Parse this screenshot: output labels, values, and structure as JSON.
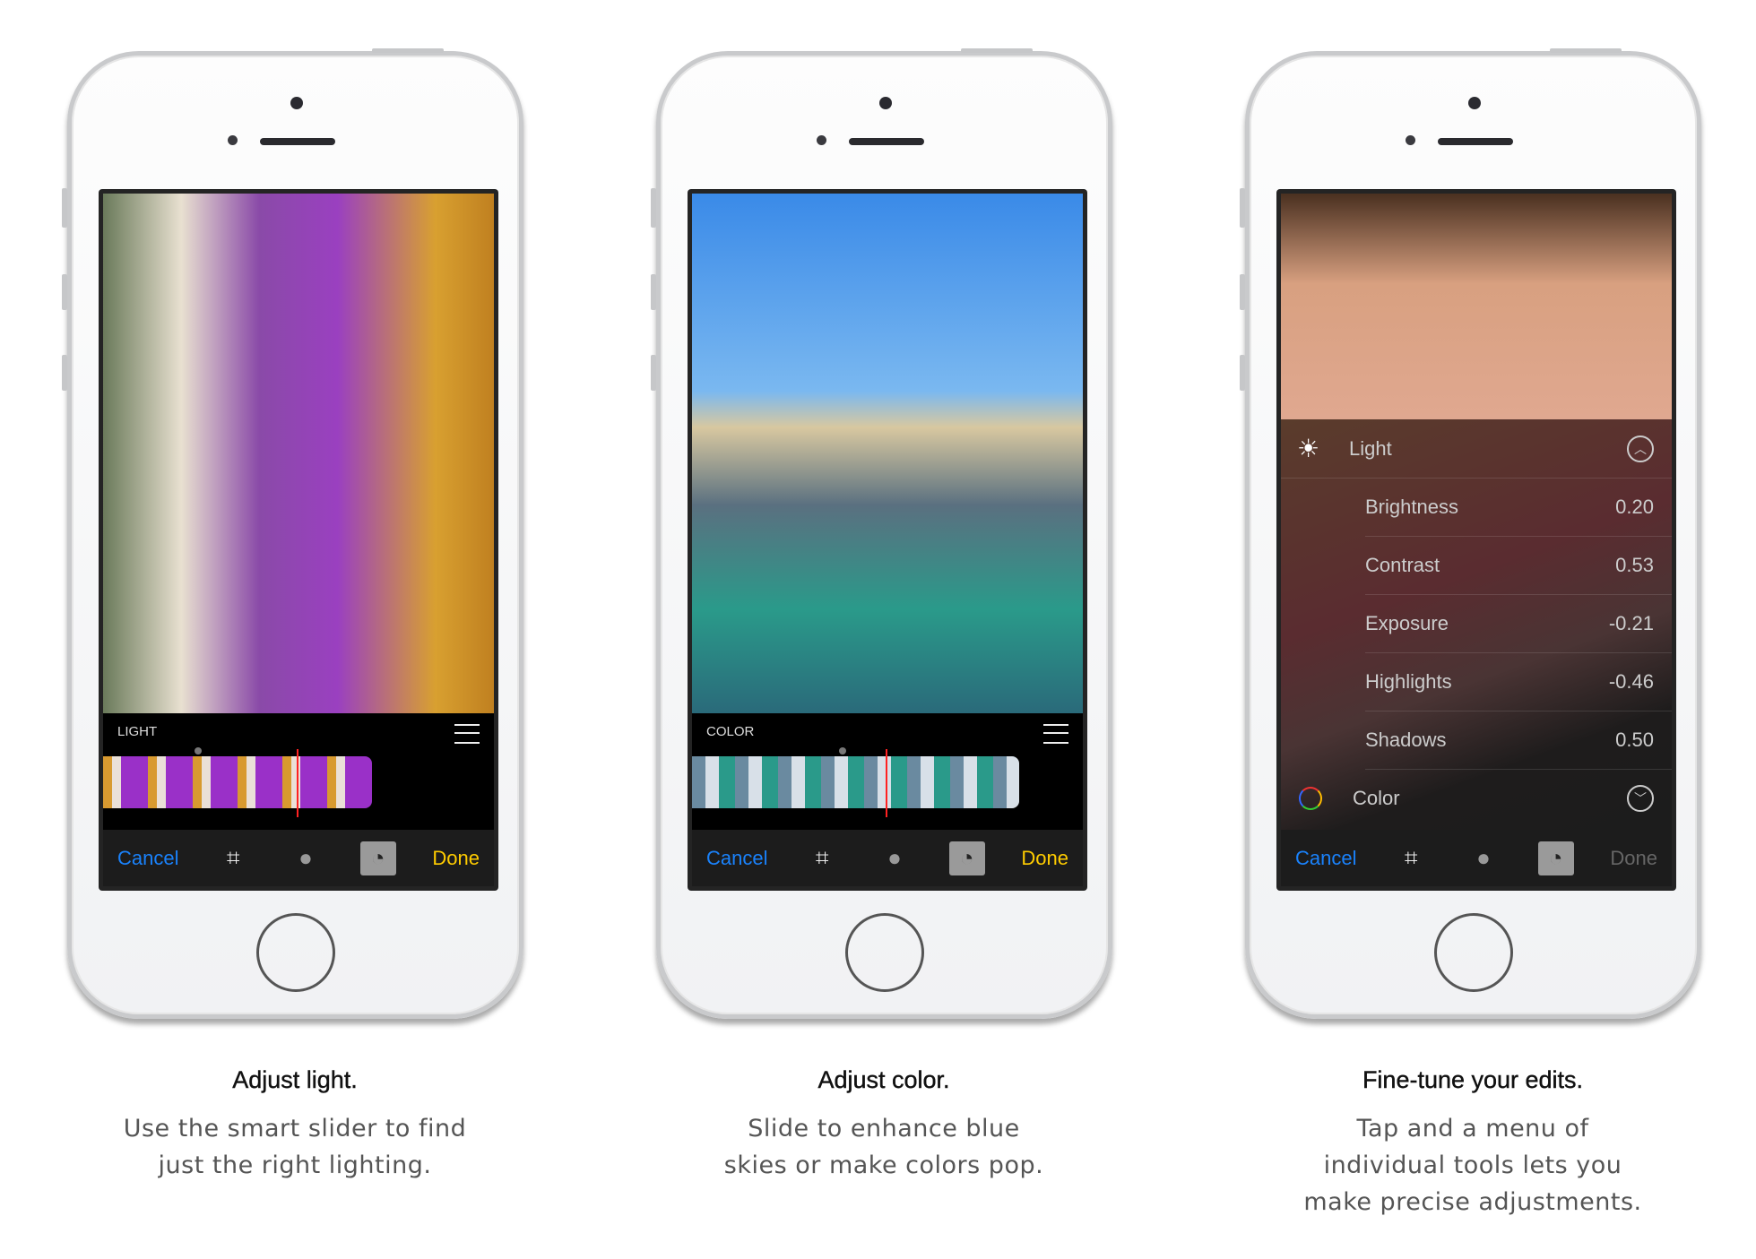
{
  "phones": [
    {
      "mode": "light",
      "control_label": "LIGHT",
      "cancel": "Cancel",
      "done": "Done",
      "done_color": "#ffcc00",
      "photo": "girl-popsicle-porch",
      "caption": {
        "title": "Adjust light.",
        "body": "Use the smart slider to find just the right lighting."
      }
    },
    {
      "mode": "color",
      "control_label": "COLOR",
      "cancel": "Cancel",
      "done": "Done",
      "done_color": "#ffcc00",
      "photo": "girl-beach-binoculars",
      "caption": {
        "title": "Adjust color.",
        "body": "Slide to enhance blue skies or make colors pop."
      }
    },
    {
      "mode": "menu",
      "cancel": "Cancel",
      "done": "Done",
      "done_color": "#666666",
      "photo": "girl-face-closeup",
      "menu": {
        "light_label": "Light",
        "color_label": "Color",
        "items": [
          {
            "label": "Brightness",
            "value": "0.20"
          },
          {
            "label": "Contrast",
            "value": "0.53"
          },
          {
            "label": "Exposure",
            "value": "-0.21"
          },
          {
            "label": "Highlights",
            "value": "-0.46"
          },
          {
            "label": "Shadows",
            "value": "0.50"
          }
        ]
      },
      "caption": {
        "title": "Fine-tune your edits.",
        "body": "Tap and a menu of individual tools lets you make precise adjustments."
      }
    }
  ],
  "accent": "#1a82fb",
  "icons": [
    "crop-icon",
    "filters-icon",
    "adjust-dial-icon",
    "list-icon",
    "sun-icon",
    "color-wheel-icon"
  ]
}
